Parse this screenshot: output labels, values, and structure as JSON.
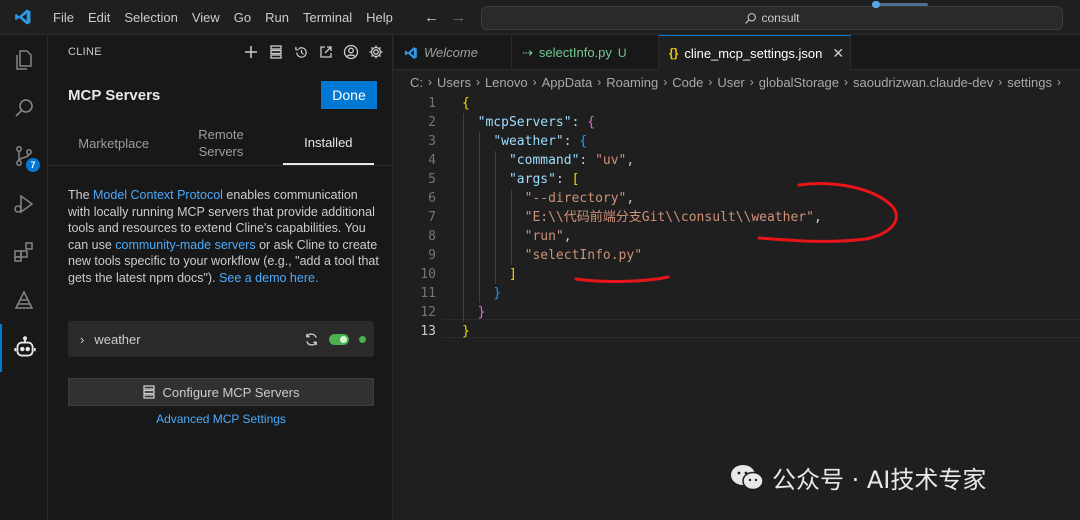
{
  "menu": [
    "File",
    "Edit",
    "Selection",
    "View",
    "Go",
    "Run",
    "Terminal",
    "Help"
  ],
  "command_center": {
    "text": "consult"
  },
  "activity_bar": {
    "source_control_badge": "7"
  },
  "sidebar": {
    "header": "CLINE",
    "title": "MCP Servers",
    "done_label": "Done",
    "tabs": [
      {
        "label": "Marketplace"
      },
      {
        "label": "Remote Servers"
      },
      {
        "label": "Installed"
      }
    ],
    "description": {
      "t1": "The ",
      "link1": "Model Context Protocol",
      "t2": " enables communication with locally running MCP servers that provide additional tools and resources to extend Cline's capabilities. You can use ",
      "link2": "community-made servers",
      "t3": " or ask Cline to create new tools specific to your workflow (e.g., \"add a tool that gets the latest npm docs\"). ",
      "link3": "See a demo here."
    },
    "server": {
      "name": "weather",
      "enabled": true
    },
    "configure_label": "Configure MCP Servers",
    "advanced_label": "Advanced MCP Settings"
  },
  "editor": {
    "tabs": [
      {
        "label": "Welcome",
        "icon": "vscode-icon"
      },
      {
        "label": "selectInfo.py",
        "status": "U",
        "icon": "python-icon"
      },
      {
        "label": "cline_mcp_settings.json",
        "icon": "json-icon",
        "active": true
      }
    ],
    "breadcrumb": [
      "C:",
      "Users",
      "Lenovo",
      "AppData",
      "Roaming",
      "Code",
      "User",
      "globalStorage",
      "saoudrizwan.claude-dev",
      "settings"
    ],
    "lines": [
      {
        "n": "1",
        "parts": [
          {
            "c": "b1",
            "t": "{"
          }
        ]
      },
      {
        "n": "2",
        "parts": [
          {
            "c": "p",
            "t": "  "
          },
          {
            "c": "k",
            "t": "\"mcpServers\""
          },
          {
            "c": "p",
            "t": ": "
          },
          {
            "c": "b2",
            "t": "{"
          }
        ]
      },
      {
        "n": "3",
        "parts": [
          {
            "c": "p",
            "t": "    "
          },
          {
            "c": "k",
            "t": "\"weather\""
          },
          {
            "c": "p",
            "t": ": "
          },
          {
            "c": "b3",
            "t": "{"
          }
        ]
      },
      {
        "n": "4",
        "parts": [
          {
            "c": "p",
            "t": "      "
          },
          {
            "c": "k",
            "t": "\"command\""
          },
          {
            "c": "p",
            "t": ": "
          },
          {
            "c": "s",
            "t": "\"uv\""
          },
          {
            "c": "p",
            "t": ","
          }
        ]
      },
      {
        "n": "5",
        "parts": [
          {
            "c": "p",
            "t": "      "
          },
          {
            "c": "k",
            "t": "\"args\""
          },
          {
            "c": "p",
            "t": ": "
          },
          {
            "c": "b1",
            "t": "["
          }
        ]
      },
      {
        "n": "6",
        "parts": [
          {
            "c": "p",
            "t": "        "
          },
          {
            "c": "s",
            "t": "\"--directory\""
          },
          {
            "c": "p",
            "t": ","
          }
        ]
      },
      {
        "n": "7",
        "parts": [
          {
            "c": "p",
            "t": "        "
          },
          {
            "c": "s",
            "t": "\"E:\\\\代码前端分支Git\\\\consult\\\\weather\""
          },
          {
            "c": "p",
            "t": ","
          }
        ]
      },
      {
        "n": "8",
        "parts": [
          {
            "c": "p",
            "t": "        "
          },
          {
            "c": "s",
            "t": "\"run\""
          },
          {
            "c": "p",
            "t": ","
          }
        ]
      },
      {
        "n": "9",
        "parts": [
          {
            "c": "p",
            "t": "        "
          },
          {
            "c": "s",
            "t": "\"selectInfo.py\""
          }
        ]
      },
      {
        "n": "10",
        "parts": [
          {
            "c": "p",
            "t": "      "
          },
          {
            "c": "b1",
            "t": "]"
          }
        ]
      },
      {
        "n": "11",
        "parts": [
          {
            "c": "p",
            "t": "    "
          },
          {
            "c": "b3",
            "t": "}"
          }
        ]
      },
      {
        "n": "12",
        "parts": [
          {
            "c": "p",
            "t": "  "
          },
          {
            "c": "b2",
            "t": "}"
          }
        ]
      },
      {
        "n": "13",
        "parts": [
          {
            "c": "b1",
            "t": "}"
          }
        ],
        "current": true
      }
    ]
  },
  "watermark": {
    "text": "公众号 · AI技术专家"
  },
  "colors": {
    "accent": "#0078d4",
    "annotation": "#e8141a",
    "toggle_on": "#4caf50"
  }
}
